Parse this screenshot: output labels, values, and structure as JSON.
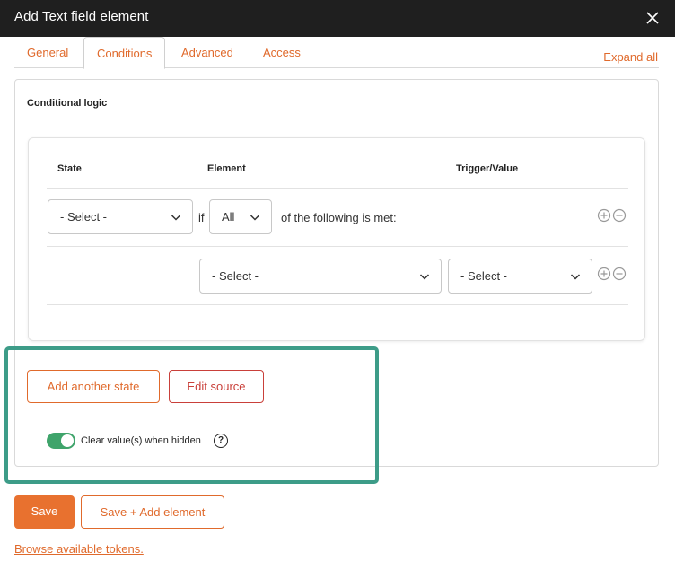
{
  "window": {
    "title": "Add Text field element"
  },
  "tabs": [
    {
      "label": "General"
    },
    {
      "label": "Conditions"
    },
    {
      "label": "Advanced"
    },
    {
      "label": "Access"
    }
  ],
  "active_tab": "Conditions",
  "expand_all": "Expand all",
  "conditional_logic": {
    "label": "Conditional logic",
    "columns": [
      "State",
      "Element",
      "Trigger/Value"
    ],
    "row1": {
      "state_select": "- Select -",
      "if_text": "if",
      "quantifier_select": "All",
      "suffix_text": "of the following is met:"
    },
    "row2": {
      "element_select": "- Select -",
      "trigger_select": "- Select -"
    }
  },
  "actions": {
    "add_state": "Add another state",
    "edit_source": "Edit source",
    "clear_values_label": "Clear value(s) when hidden",
    "clear_values_checked": true,
    "help_glyph": "?"
  },
  "footer": {
    "save": "Save",
    "save_add": "Save + Add element",
    "tokens_link": "Browse available tokens."
  },
  "colors": {
    "accent": "#e06a2c",
    "save_bg": "#e8712f",
    "toggle_on": "#3fa46b",
    "highlight": "#3d9c88",
    "titlebar": "#1f1f1f"
  },
  "icons": [
    "close-icon",
    "chevron-down-icon",
    "plus-circle-icon",
    "minus-circle-icon",
    "help-icon"
  ]
}
